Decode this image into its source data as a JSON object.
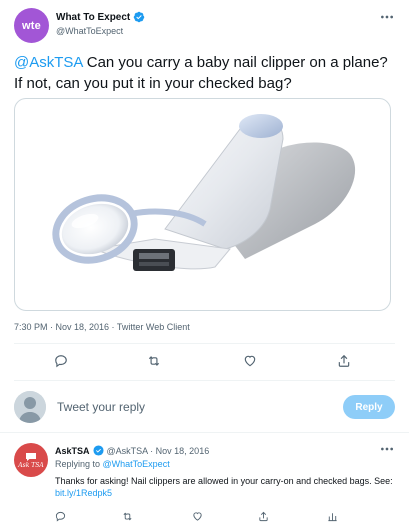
{
  "tweet": {
    "avatar_text": "wte",
    "author_name": "What To Expect",
    "author_handle": "@WhatToExpect",
    "mention": "@AskTSA",
    "text": " Can you carry a baby nail clipper on a plane? If not, can you put it in your checked bag?",
    "timestamp": "7:30 PM · Nov 18, 2016 · Twitter Web Client",
    "media_alt": "baby nail clipper with magnifying glass",
    "accent_color": "#1d9bf0",
    "brand_color": "#a256d6"
  },
  "actions": [
    "reply-icon",
    "retweet-icon",
    "like-icon",
    "share-icon"
  ],
  "reply_box": {
    "placeholder": "Tweet your reply",
    "button_label": "Reply"
  },
  "reply_tweet": {
    "avatar_text": "Ask TSA",
    "author_name": "AskTSA",
    "sub": "@AskTSA · Nov 18, 2016",
    "replying_prefix": "Replying to ",
    "replying_to": "@WhatToExpect",
    "body": "Thanks for asking! Nail clippers are allowed in your carry-on and checked bags. See: ",
    "link": "bit.ly/1Redpk5",
    "brand_color": "#d94a4a"
  }
}
